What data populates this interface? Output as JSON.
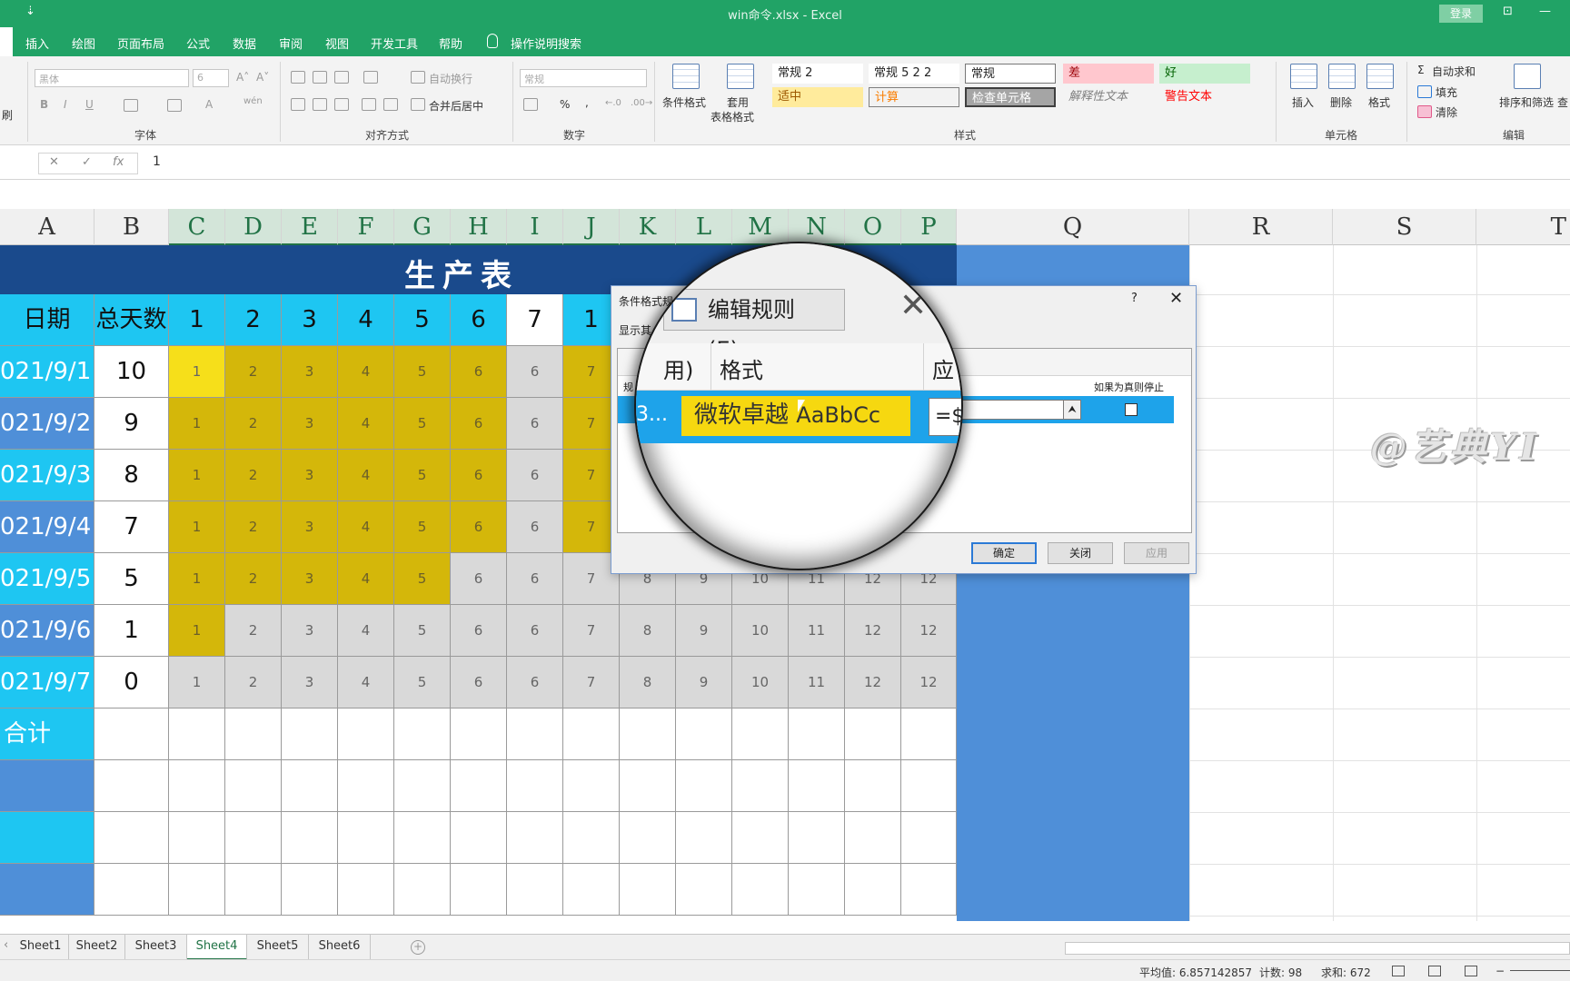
{
  "app": {
    "doc_title": "win命令.xlsx  -  Excel",
    "qat_symbol": "⇣",
    "login_label": "登录",
    "win_restore": "⊡",
    "win_close_symbol": "✕"
  },
  "tabs": [
    "插入",
    "绘图",
    "页面布局",
    "公式",
    "数据",
    "审阅",
    "视图",
    "开发工具",
    "帮助",
    "操作说明搜索"
  ],
  "ribbon": {
    "left_cut_label": "刷",
    "font": {
      "name": "黑体",
      "size": "6",
      "group_label": "字体",
      "bold": "B",
      "italic": "I",
      "underline": "U",
      "grow": "A˄",
      "shrink": "A˅",
      "color_a": "A",
      "wen": "wén"
    },
    "align": {
      "group_label": "对齐方式",
      "wrap": "自动换行",
      "merge": "合并后居中"
    },
    "number": {
      "format": "常规",
      "group_label": "数字",
      "percent": "%",
      "comma": ",",
      "inc": "←.0",
      "dec": ".00→"
    },
    "styles": {
      "group_label": "样式",
      "cond_format": "条件格式",
      "table_format_1": "套用",
      "table_format_2": "表格格式",
      "cells": [
        {
          "label": "常规 2"
        },
        {
          "label": "常规 5 2 2"
        },
        {
          "label": "常规"
        },
        {
          "label": "差"
        },
        {
          "label": "好"
        },
        {
          "label": "适中"
        },
        {
          "label": "计算"
        },
        {
          "label": "检查单元格"
        },
        {
          "label": "解释性文本"
        },
        {
          "label": "警告文本"
        }
      ]
    },
    "cells_group": {
      "group_label": "单元格",
      "insert": "插入",
      "delete": "删除",
      "format": "格式"
    },
    "edit_group": {
      "group_label": "编辑",
      "autosum": "自动求和",
      "fill": "填充",
      "clear": "清除",
      "sort": "排序和筛选",
      "find_cut": "查"
    }
  },
  "formula_bar": {
    "cancel": "✕",
    "enter": "✓",
    "fx": "fx",
    "value": "1"
  },
  "columns": [
    "A",
    "B",
    "C",
    "D",
    "E",
    "F",
    "G",
    "H",
    "I",
    "J",
    "K",
    "L",
    "M",
    "N",
    "O",
    "P",
    "Q",
    "R",
    "S",
    "T"
  ],
  "sheet": {
    "title": "生产表",
    "header_date": "日期",
    "header_days": "总天数",
    "header_nums": [
      "1",
      "2",
      "3",
      "4",
      "5",
      "6",
      "7",
      "1",
      "",
      "",
      "",
      "",
      "",
      ""
    ],
    "rows": [
      {
        "date": "021/9/1",
        "days": "10",
        "values": [
          "1",
          "2",
          "3",
          "4",
          "5",
          "6",
          "6",
          "7",
          "",
          "",
          "",
          "",
          "",
          ""
        ]
      },
      {
        "date": "021/9/2",
        "days": "9",
        "values": [
          "1",
          "2",
          "3",
          "4",
          "5",
          "6",
          "6",
          "7",
          "",
          "",
          "",
          "",
          "",
          ""
        ]
      },
      {
        "date": "021/9/3",
        "days": "8",
        "values": [
          "1",
          "2",
          "3",
          "4",
          "5",
          "6",
          "6",
          "7",
          "",
          "",
          "",
          "",
          "",
          ""
        ]
      },
      {
        "date": "021/9/4",
        "days": "7",
        "values": [
          "1",
          "2",
          "3",
          "4",
          "5",
          "6",
          "6",
          "7",
          "",
          "",
          "",
          "",
          "",
          ""
        ]
      },
      {
        "date": "021/9/5",
        "days": "5",
        "values": [
          "1",
          "2",
          "3",
          "4",
          "5",
          "6",
          "6",
          "7",
          "8",
          "9",
          "10",
          "11",
          "12",
          "12"
        ]
      },
      {
        "date": "021/9/6",
        "days": "1",
        "values": [
          "1",
          "2",
          "3",
          "4",
          "5",
          "6",
          "6",
          "7",
          "8",
          "9",
          "10",
          "11",
          "12",
          "12"
        ]
      },
      {
        "date": "021/9/7",
        "days": "0",
        "values": [
          "1",
          "2",
          "3",
          "4",
          "5",
          "6",
          "6",
          "7",
          "8",
          "9",
          "10",
          "11",
          "12",
          "12"
        ]
      }
    ],
    "total_label": "合计",
    "watermark": "@艺典YI"
  },
  "dialog": {
    "title": "条件格式规",
    "help": "?",
    "close": "✕",
    "show_label": "显示其",
    "rule_col_cut": "规",
    "stop_header": "如果为真则停止",
    "up_button": "⮝",
    "ok": "确定",
    "close_btn": "关闭",
    "apply": "应用"
  },
  "magnifier": {
    "edit_rule": "编辑规则(E)...",
    "delete_x": "✕",
    "col_rule_cut": "用)",
    "col_format": "格式",
    "col_apply_cut": "应",
    "row_rule_cut": "3...",
    "preview_cn": "微软卓越",
    "preview_latin": "AaBbCc",
    "formula_cut": "=$"
  },
  "sheet_tabs": [
    "Sheet1",
    "Sheet2",
    "Sheet3",
    "Sheet4",
    "Sheet5",
    "Sheet6"
  ],
  "active_sheet": "Sheet4",
  "status": {
    "average": "平均值: 6.857142857",
    "count": "计数: 98",
    "sum": "求和: 672"
  }
}
